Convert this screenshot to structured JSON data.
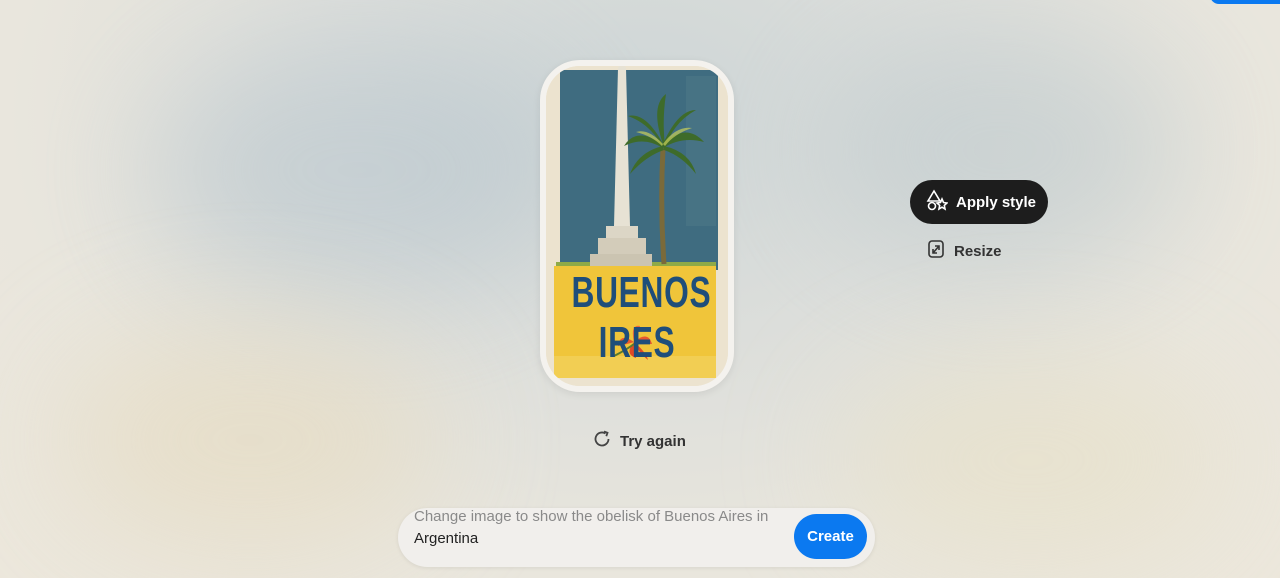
{
  "poster": {
    "title": "BUENOS IRES"
  },
  "actions": {
    "apply_style_label": "Apply style",
    "resize_label": "Resize",
    "try_again_label": "Try again"
  },
  "prompt": {
    "line1": "Change image to show the obelisk of Buenos Aires in",
    "line2": "Argentina",
    "create_label": "Create"
  },
  "colors": {
    "accent": "#0b79f0",
    "dark_button": "#1d1d1d"
  },
  "icons": [
    "shapes-icon",
    "resize-icon",
    "refresh-icon"
  ]
}
